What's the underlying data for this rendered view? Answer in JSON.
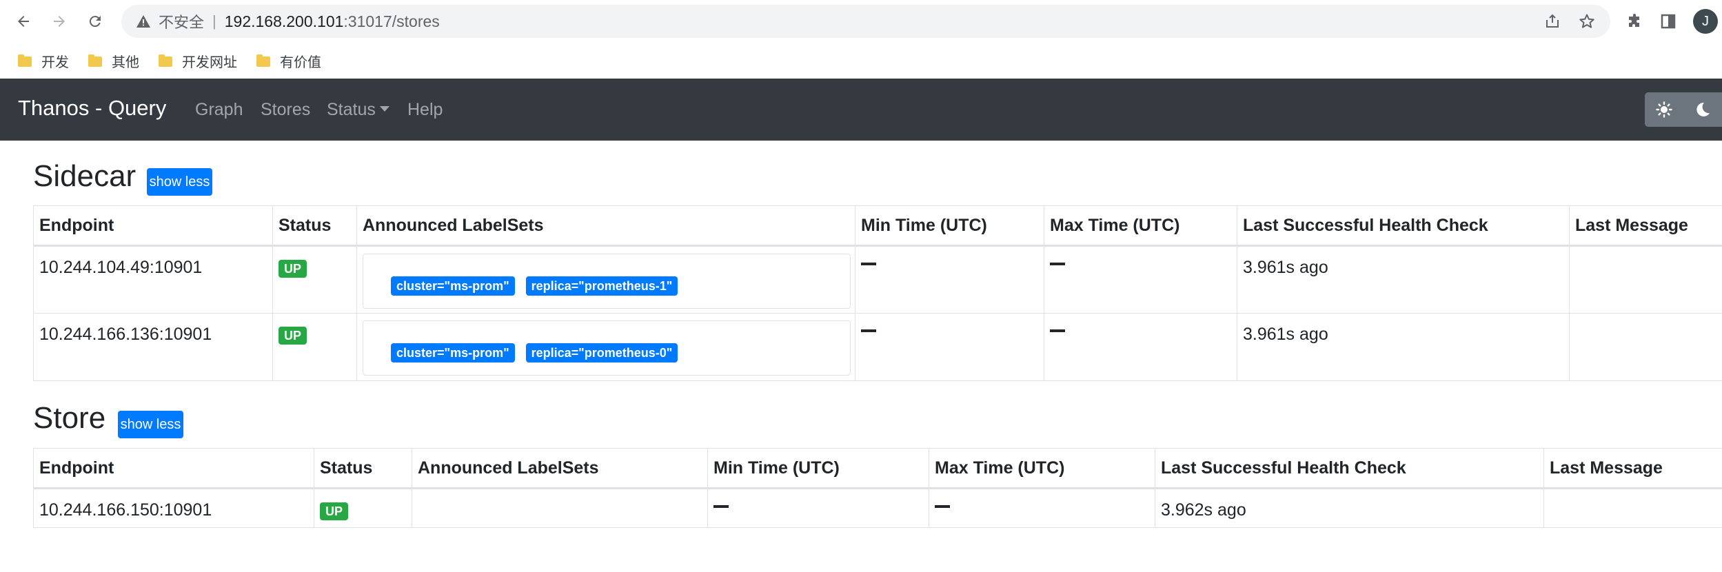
{
  "browser": {
    "insecure_label": "不安全",
    "separator": "|",
    "url_host": "192.168.200.101",
    "url_path": ":31017/stores",
    "avatar_letter": "J",
    "bookmarks": [
      "开发",
      "其他",
      "开发网址",
      "有价值"
    ]
  },
  "navbar": {
    "brand": "Thanos - Query",
    "links": [
      "Graph",
      "Stores",
      "Status",
      "Help"
    ]
  },
  "sections": {
    "sidecar": {
      "title": "Sidecar",
      "toggle_label": "show less",
      "headers": [
        "Endpoint",
        "Status",
        "Announced LabelSets",
        "Min Time (UTC)",
        "Max Time (UTC)",
        "Last Successful Health Check",
        "Last Message"
      ],
      "rows": [
        {
          "endpoint": "10.244.104.49:10901",
          "status": "UP",
          "labels": [
            "cluster=\"ms-prom\"",
            "replica=\"prometheus-1\""
          ],
          "health": "3.961s ago",
          "message": ""
        },
        {
          "endpoint": "10.244.166.136:10901",
          "status": "UP",
          "labels": [
            "cluster=\"ms-prom\"",
            "replica=\"prometheus-0\""
          ],
          "health": "3.961s ago",
          "message": ""
        }
      ]
    },
    "store": {
      "title": "Store",
      "toggle_label": "show less",
      "headers": [
        "Endpoint",
        "Status",
        "Announced LabelSets",
        "Min Time (UTC)",
        "Max Time (UTC)",
        "Last Successful Health Check",
        "Last Message"
      ],
      "rows": [
        {
          "endpoint": "10.244.166.150:10901",
          "status": "UP",
          "health": "3.962s ago",
          "message": ""
        }
      ]
    }
  },
  "colors": {
    "navbar_bg": "#343a40",
    "primary": "#007bff",
    "success": "#28a745"
  }
}
